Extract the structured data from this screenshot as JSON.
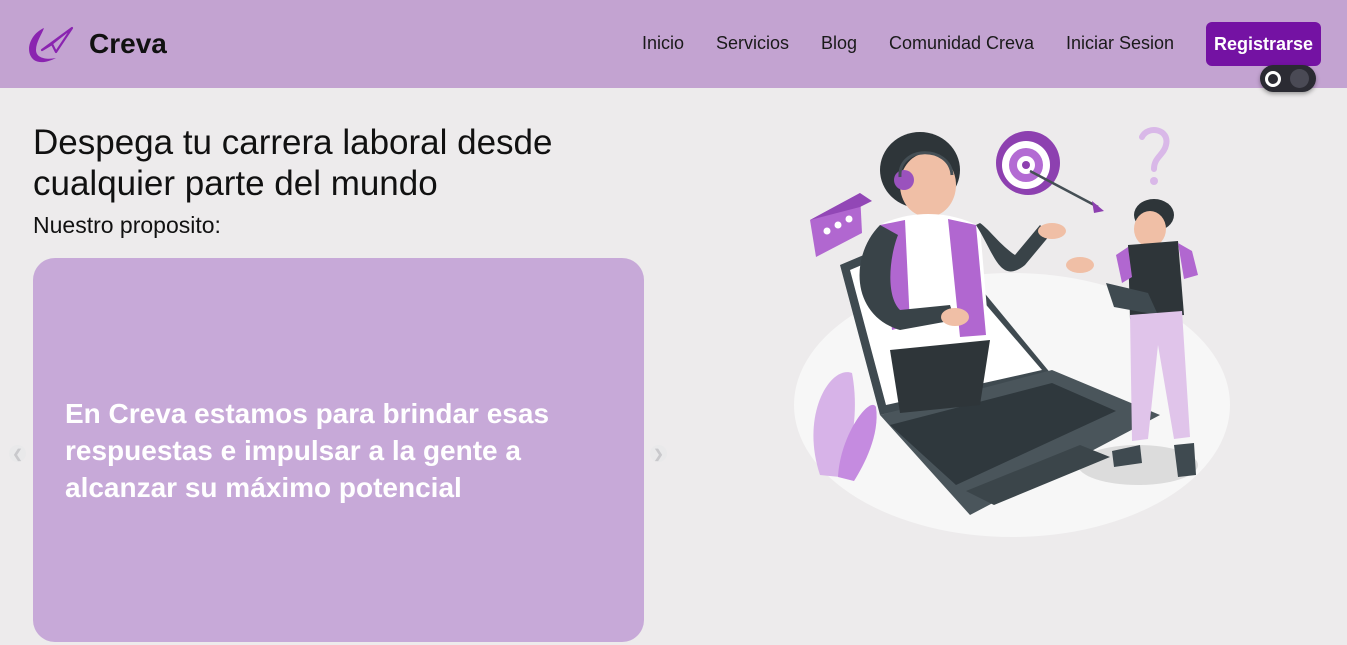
{
  "brand": {
    "name": "Creva",
    "logo_icon": "paper-plane-logo-icon"
  },
  "nav": {
    "links": [
      "Inicio",
      "Servicios",
      "Blog",
      "Comunidad Creva",
      "Iniciar Sesion"
    ],
    "register_label": "Registrarse"
  },
  "theme_toggle": {
    "state": "light"
  },
  "hero": {
    "title": "Despega tu carrera laboral desde cualquier parte del mundo",
    "subtitle": "Nuestro proposito:"
  },
  "carousel": {
    "slide_text": "En Creva estamos para brindar esas respuestas e impulsar a la gente a alcanzar su máximo potencial",
    "prev_icon": "chevron-left-icon",
    "next_icon": "chevron-right-icon"
  },
  "colors": {
    "navbar": "#c3a3d1",
    "accent": "#7412a3",
    "card": "#c7a9d8",
    "background": "#edebec"
  }
}
